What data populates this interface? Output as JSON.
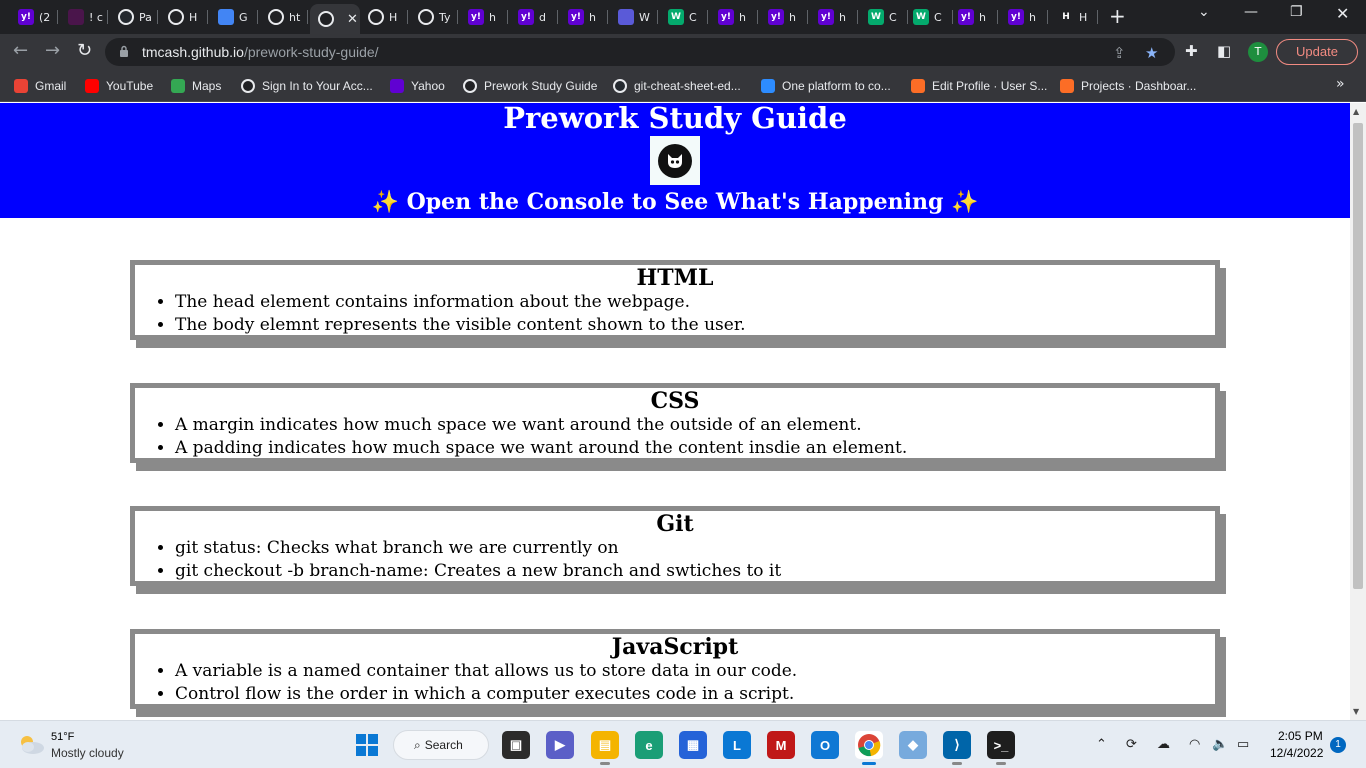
{
  "browser": {
    "tabs": [
      {
        "title": "(2",
        "icon": "yahoo-mail-icon",
        "color": "#6001d2"
      },
      {
        "title": "! c",
        "icon": "slack-icon",
        "color": "#4a154b"
      },
      {
        "title": "Pa",
        "icon": "github-icon",
        "color": "#24292f"
      },
      {
        "title": "H",
        "icon": "globe-icon",
        "color": "#202124"
      },
      {
        "title": "G",
        "icon": "book-icon",
        "color": "#4285f4"
      },
      {
        "title": "ht",
        "icon": "globe-icon",
        "color": "#202124"
      },
      {
        "title": "",
        "icon": "globe-icon",
        "color": "#202124",
        "active": true
      },
      {
        "title": "H",
        "icon": "globe-icon",
        "color": "#202124"
      },
      {
        "title": "Ty",
        "icon": "globe-icon",
        "color": "#202124"
      },
      {
        "title": "h",
        "icon": "yahoo-icon",
        "color": "#6001d2"
      },
      {
        "title": "d",
        "icon": "yahoo-icon",
        "color": "#6001d2"
      },
      {
        "title": "h",
        "icon": "yahoo-icon",
        "color": "#6001d2"
      },
      {
        "title": "W",
        "icon": "c-icon",
        "color": "#5a5ad8"
      },
      {
        "title": "C",
        "icon": "w3schools-icon",
        "color": "#04aa6d"
      },
      {
        "title": "h",
        "icon": "yahoo-icon",
        "color": "#6001d2"
      },
      {
        "title": "h",
        "icon": "yahoo-icon",
        "color": "#6001d2"
      },
      {
        "title": "h",
        "icon": "yahoo-icon",
        "color": "#6001d2"
      },
      {
        "title": "C",
        "icon": "w3schools-icon",
        "color": "#04aa6d"
      },
      {
        "title": "C",
        "icon": "w3schools-icon",
        "color": "#04aa6d"
      },
      {
        "title": "h",
        "icon": "yahoo-icon",
        "color": "#6001d2"
      },
      {
        "title": "h",
        "icon": "yahoo-icon",
        "color": "#6001d2"
      },
      {
        "title": "H",
        "icon": "htg-icon",
        "color": "#202124"
      }
    ],
    "url_host": "tmcash.github.io",
    "url_path": "/prework-study-guide/",
    "update_label": "Update",
    "profile_initial": "T",
    "bookmarks": [
      {
        "label": "Gmail",
        "icon": "gmail-icon",
        "color": "#ea4335"
      },
      {
        "label": "YouTube",
        "icon": "youtube-icon",
        "color": "#ff0000"
      },
      {
        "label": "Maps",
        "icon": "maps-icon",
        "color": "#34a853"
      },
      {
        "label": "Sign In to Your Acc...",
        "icon": "globe-icon",
        "color": "#202124"
      },
      {
        "label": "Yahoo",
        "icon": "yahoo-icon",
        "color": "#6001d2"
      },
      {
        "label": "Prework Study Guide",
        "icon": "globe-icon",
        "color": "#202124"
      },
      {
        "label": "git-cheat-sheet-ed...",
        "icon": "github-icon",
        "color": "#24292f"
      },
      {
        "label": "One platform to co...",
        "icon": "zoom-icon",
        "color": "#2d8cff"
      },
      {
        "label": "Edit Profile · User S...",
        "icon": "gitlab-icon",
        "color": "#fc6d26"
      },
      {
        "label": "Projects · Dashboar...",
        "icon": "gitlab-icon",
        "color": "#fc6d26"
      }
    ]
  },
  "page": {
    "title": "Prework Study Guide",
    "subtitle": "✨ Open the Console to See What's Happening ✨",
    "hero_color": "#0000ff",
    "sections": [
      {
        "heading": "HTML",
        "items": [
          "The head element contains information about the webpage.",
          "The body elemnt represents the visible content shown to the user."
        ]
      },
      {
        "heading": "CSS",
        "items": [
          "A margin indicates how much space we want around the outside of an element.",
          "A padding indicates how much space we want around the content insdie an element."
        ]
      },
      {
        "heading": "Git",
        "items": [
          "git status: Checks what branch we are currently on",
          "git checkout -b branch-name: Creates a new branch and swtiches to it"
        ]
      },
      {
        "heading": "JavaScript",
        "items": [
          "A variable is a named container that allows us to store data in our code.",
          "Control flow is the order in which a computer executes code in a script."
        ]
      }
    ]
  },
  "taskbar": {
    "weather_temp": "51°F",
    "weather_desc": "Mostly cloudy",
    "search_label": "Search",
    "time": "2:05 PM",
    "date": "12/4/2022",
    "notification_count": "1"
  }
}
